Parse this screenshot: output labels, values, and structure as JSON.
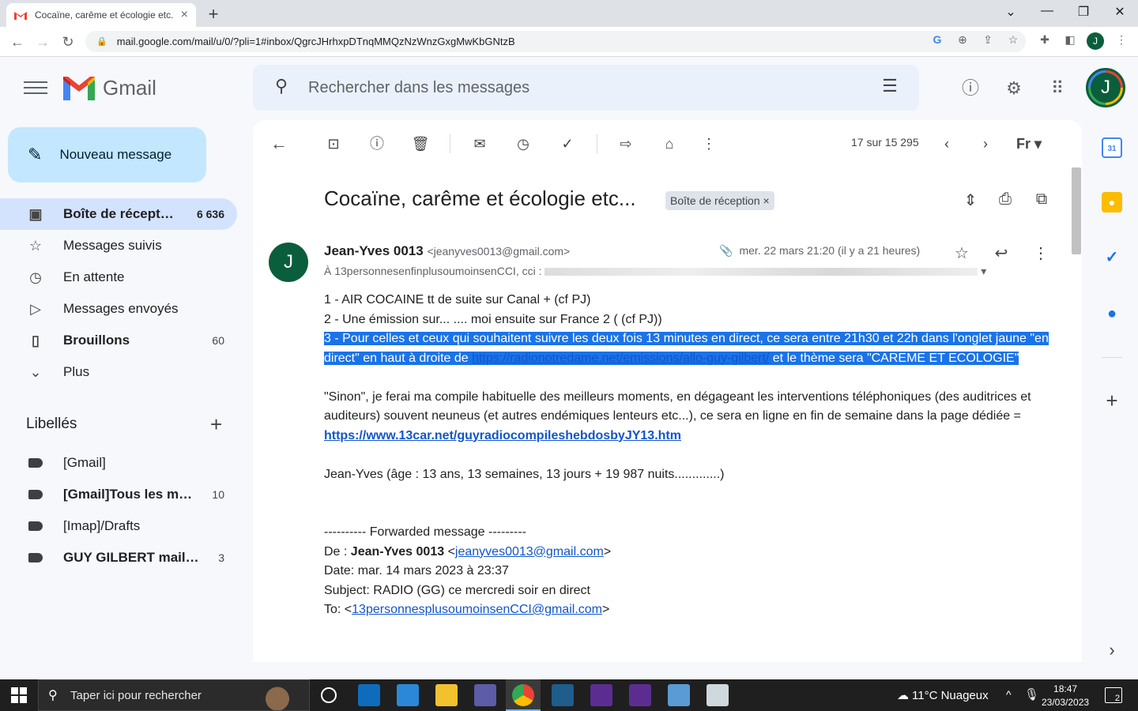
{
  "browser": {
    "tab_title": "Cocaïne, carême et écologie etc.",
    "tab_close": "×",
    "new_tab": "+",
    "url": "mail.google.com/mail/u/0/?pli=1#inbox/QgrcJHrhxpDTnqMMQzNzWnzGxgMwKbGNtzB",
    "profile_initial": "J",
    "window_controls": [
      "⌄",
      "—",
      "❐",
      "✕"
    ]
  },
  "gmail": {
    "brand": "Gmail",
    "search_placeholder": "Rechercher dans les messages",
    "account_initial": "J",
    "compose_label": "Nouveau message",
    "nav": [
      {
        "label": "Boîte de récept…",
        "count": "6 636",
        "icon": "inbox-icon"
      },
      {
        "label": "Messages suivis",
        "count": "",
        "icon": "star-icon"
      },
      {
        "label": "En attente",
        "count": "",
        "icon": "clock-icon"
      },
      {
        "label": "Messages envoyés",
        "count": "",
        "icon": "send-icon"
      },
      {
        "label": "Brouillons",
        "count": "60",
        "icon": "draft-icon"
      },
      {
        "label": "Plus",
        "count": "",
        "icon": "chevron-down-icon"
      }
    ],
    "labels_heading": "Libellés",
    "labels": [
      {
        "label": "[Gmail]",
        "count": ""
      },
      {
        "label": "[Gmail]Tous les m…",
        "count": "10"
      },
      {
        "label": "[Imap]/Drafts",
        "count": ""
      },
      {
        "label": "GUY GILBERT mail…",
        "count": "3"
      }
    ]
  },
  "toolbar": {
    "pager": "17 sur 15 295",
    "lang": "Fr"
  },
  "message": {
    "subject": "Cocaïne, carême et écologie etc...",
    "label_chip": "Boîte de réception",
    "label_chip_close": "×",
    "sender_initial": "J",
    "sender_name": "Jean-Yves 0013",
    "sender_email": "<jeanyves0013@gmail.com>",
    "date": "mer. 22 mars 21:20 (il y a 21 heures)",
    "to": "À 13personnesenfinplusoumoinsenCCI, cci :",
    "line1": "1 - AIR COCAINE tt de suite sur Canal + (cf PJ)",
    "line2": "2 - Une émission sur... .... moi ensuite sur France 2 ( (cf PJ))",
    "line3a": "3 - Pour celles et ceux qui souhaitent suivre les deux fois 13 minutes en direct, ce sera entre 21h30 et 22h dans l'onglet jaune \"en direct\" en haut à droite de ",
    "line3_link": "https://radionotredame.net/emissions/allo-guy-gilbert/",
    "line3b": " et le thème sera \"CAREME ET ECOLOGIE\"",
    "para2": "\"Sinon\", je ferai ma compile habituelle des meilleurs moments, en dégageant les interventions téléphoniques (des auditrices et auditeurs)  souvent neuneus (et autres endémiques lenteurs etc...), ce sera en ligne en fin de semaine dans la page dédiée = ",
    "para2_link": "https://www.13car.net/guyradiocompileshebdosbyJY13.htm",
    "signature": "Jean-Yves (âge : 13 ans, 13 semaines, 13 jours + 19 987  nuits.............)",
    "fwd_header": "---------- Forwarded message ---------",
    "fwd_from_prefix": "De : ",
    "fwd_from_name": "Jean-Yves 0013",
    "fwd_from_email": "jeanyves0013@gmail.com",
    "fwd_date": "Date: mar. 14 mars 2023 à 23:37",
    "fwd_subject": "Subject: RADIO (GG) ce mercredi soir en direct",
    "fwd_to_prefix": "To: <",
    "fwd_to_email": "13personnesplusoumoinsenCCI@gmail.com",
    "fwd_to_suffix": ">"
  },
  "taskbar": {
    "search_placeholder": "Taper ici pour rechercher",
    "weather": "11°C  Nuageux",
    "time": "18:47",
    "date": "23/03/2023",
    "notif_count": "2"
  },
  "colors": {
    "accent": "#1a73e8",
    "compose_bg": "#c2e7ff",
    "active_nav": "#d3e3fd",
    "avatar": "#0b5e3b"
  }
}
